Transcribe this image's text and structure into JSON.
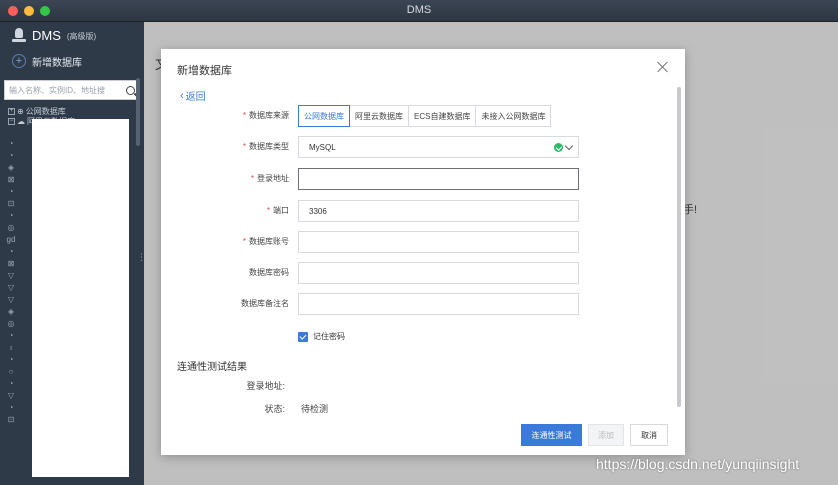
{
  "window": {
    "title": "DMS"
  },
  "sidebar": {
    "brand": "DMS",
    "brand_edition": "(高级版)",
    "new_database": "新增数据库",
    "search_placeholder": "输入名称、实例ID、地址搜",
    "tree": [
      "公网数据库",
      "阿里云数据库"
    ],
    "partial_label": "gd"
  },
  "background": {
    "left_fragment": "文",
    "right_fragment": "手!"
  },
  "modal": {
    "title": "新增数据库",
    "back": "返回",
    "fields": {
      "source": {
        "label": "数据库来源",
        "options": [
          "公网数据库",
          "阿里云数据库",
          "ECS自建数据库",
          "未接入公网数据库"
        ],
        "selected": "公网数据库"
      },
      "type": {
        "label": "数据库类型",
        "value": "MySQL"
      },
      "host": {
        "label": "登录地址",
        "value": ""
      },
      "port": {
        "label": "端口",
        "value": "3306"
      },
      "account": {
        "label": "数据库账号",
        "value": ""
      },
      "password": {
        "label": "数据库密码",
        "value": ""
      },
      "alias": {
        "label": "数据库备注名",
        "value": ""
      }
    },
    "remember_password": {
      "label": "记住密码",
      "checked": true
    },
    "test_section": {
      "title": "连通性测试结果",
      "host_label": "登录地址:",
      "host_value": "",
      "status_label": "状态:",
      "status_value": "待检测"
    },
    "buttons": {
      "test": "连通性测试",
      "add": "添加",
      "cancel": "取消"
    }
  },
  "watermark": "https://blog.csdn.net/yunqiinsight",
  "colors": {
    "accent": "#3b7ad9",
    "required": "#e64545",
    "sidebar": "#2f3a48",
    "success": "#2eb96b"
  }
}
